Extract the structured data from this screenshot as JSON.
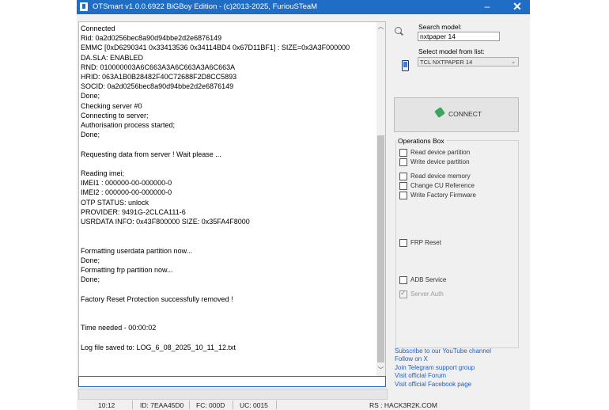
{
  "window": {
    "title": "OTSmart  v1.0.0.6922 BiGBoy Edition - (c)2013-2025, FuriouSTeaM",
    "minimize_glyph": "–",
    "close_glyph": "✕"
  },
  "log": {
    "lines": [
      "Connected",
      "Rid: 0a2d0256bec8a90d94bbe2d2e6876149",
      "EMMC [0xD6290341 0x33413536 0x34114BD4 0x67D11BF1] : SIZE=0x3A3F000000",
      "DA.SLA: ENABLED",
      "RND: 010000003A6C663A3A6C663A3A6C663A",
      "HRID: 063A1B0B28482F40C72688F2D8CC5893",
      "SOCID: 0a2d0256bec8a90d94bbe2d2e6876149",
      "Done;",
      "Checking server #0",
      "Connecting to server;",
      "Authorisation process started;",
      "Done;",
      "",
      "Requesting data from server ! Wait please ...",
      "",
      "Reading imei;",
      "IMEI1 : 000000-00-000000-0",
      "IMEI2 : 000000-00-000000-0",
      "OTP STATUS: unlock",
      "PROVIDER: 9491G-2CLCA111-6",
      "USRDATA INFO: 0x43F800000 SIZE: 0x35FA4F8000",
      "",
      "",
      "Formatting userdata partition now...",
      "Done;",
      "Formatting frp partition now...",
      "Done;",
      "",
      "Factory Reset Protection successfully removed !",
      "",
      "",
      "Time needed - 00:00:02",
      "",
      "Log file saved to: LOG_6_08_2025_10_11_12.txt"
    ],
    "command_value": ""
  },
  "search": {
    "label": "Search model:",
    "value": "nxtpaper 14",
    "icon": "search-icon"
  },
  "model": {
    "label": "Select model from list:",
    "selected": "TCL NXTPAPER 14",
    "icon": "phone-icon"
  },
  "connect": {
    "label": "CONNECT",
    "icon": "plug-icon"
  },
  "operations": {
    "title": "Operations Box",
    "read_partition": "Read device partition",
    "write_partition": "Write device partition",
    "read_memory": "Read device memory",
    "change_cu": "Change CU Reference",
    "write_firmware": "Write Factory Firmware",
    "frp_reset": "FRP Reset",
    "adb_service": "ADB Service",
    "server_auth": "Server Auth",
    "server_auth_checked": true
  },
  "links": {
    "youtube": "Subscribe to our YouTube channel",
    "follow_x": "Follow on X",
    "telegram": "Join Telegram support group",
    "forum": "Visit official Forum",
    "facebook": "Visit official Facebook page"
  },
  "status": {
    "time": "10:12",
    "id": "ID: 7EAA45D0",
    "fc": "FC: 000D",
    "uc": "UC: 0015",
    "rs": "RS : HACK3R2K.COM"
  },
  "colors": {
    "titlebar": "#1f6dc4",
    "link": "#1f5ec9"
  }
}
